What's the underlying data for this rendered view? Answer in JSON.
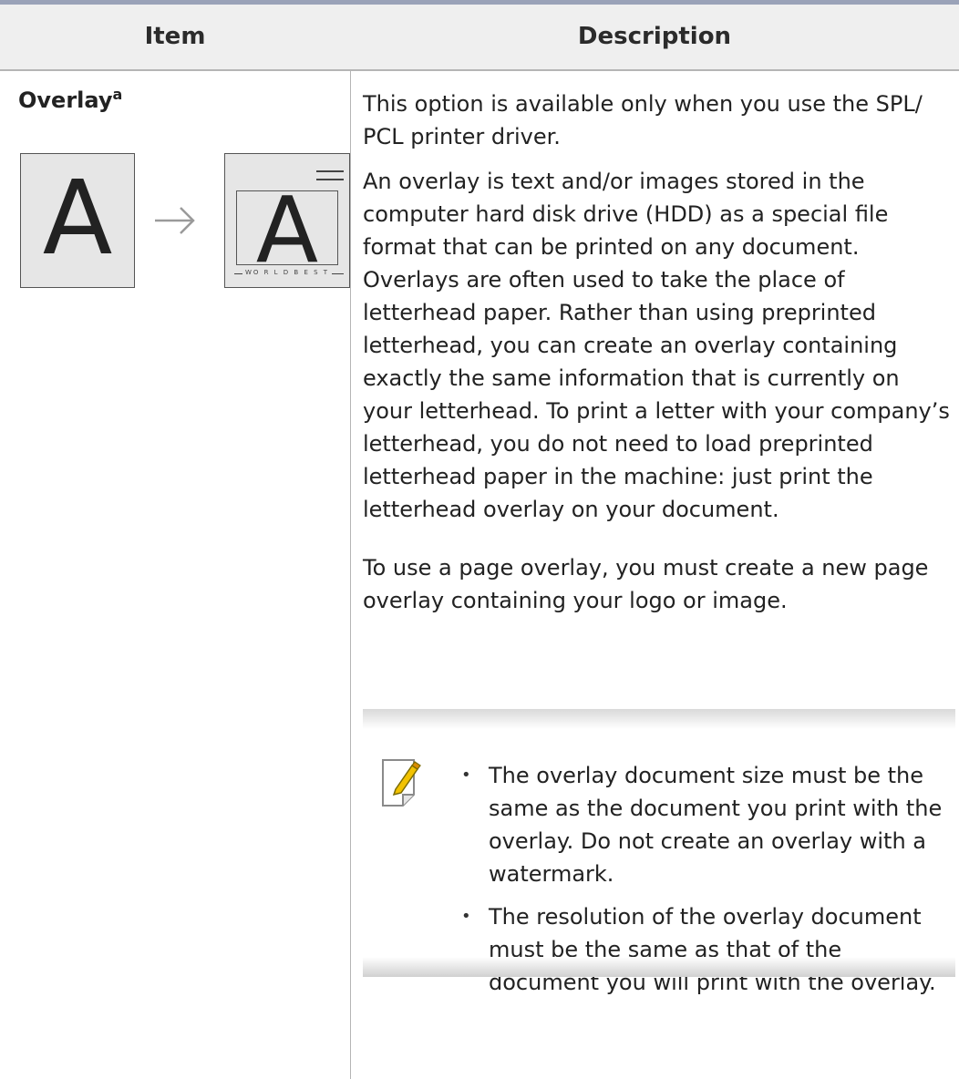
{
  "table": {
    "header": {
      "item": "Item",
      "description": "Description"
    },
    "row": {
      "item_title": "Overlay",
      "item_footnote": "a",
      "illustration": {
        "before_letter": "A",
        "after_letter": "A",
        "footer_text": "WO R L D B E S T"
      },
      "paragraphs": [
        "This option is available only when you use the SPL/ PCL printer driver.",
        "An overlay is text and/or images stored in the computer hard disk drive (HDD) as a special file format that can be printed on any document. Overlays are often used to take the place of letterhead paper. Rather than using preprinted letterhead, you can create an overlay containing exactly the same information that is currently on your letterhead. To print a letter with your company’s letterhead, you do not need to load preprinted letterhead paper in the machine: just print the letterhead overlay on your document.",
        "To use a page overlay, you must create a new page overlay containing your logo or image."
      ],
      "note": {
        "icon": "note-pencil-icon",
        "bullets": [
          "The overlay document size must be the same as the document you print with the overlay. Do not create an overlay with a watermark.",
          "The resolution of the overlay document must be the same as that of the document you will print with the overlay."
        ]
      }
    }
  },
  "colors": {
    "header_bg": "#efefef",
    "top_rule": "#9aa2b8",
    "illustration_bg": "#e6e6e6",
    "note_icon_accent": "#f2c200"
  }
}
